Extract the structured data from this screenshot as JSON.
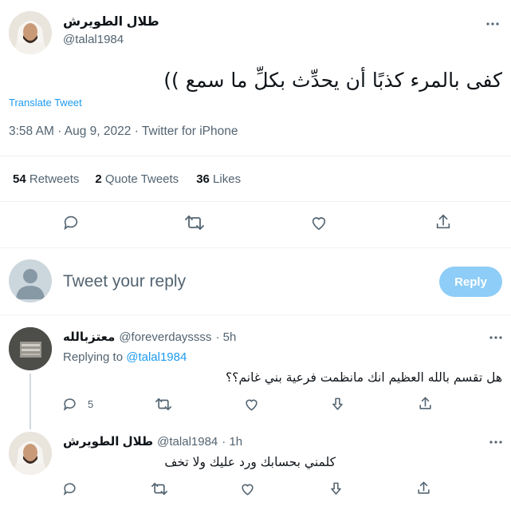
{
  "tweet": {
    "author_name": "طلال الطويرش",
    "author_handle": "@talal1984",
    "text": "كفى بالمرء كذبًا أن يحدِّث بكلِّ ما سمع ))",
    "translate_label": "Translate Tweet",
    "timestamp": "3:58 AM · Aug 9, 2022 · Twitter for iPhone",
    "stats": {
      "retweets_count": "54",
      "retweets_label": "Retweets",
      "quotes_count": "2",
      "quotes_label": "Quote Tweets",
      "likes_count": "36",
      "likes_label": "Likes"
    }
  },
  "composer": {
    "placeholder": "Tweet your reply",
    "reply_button_label": "Reply"
  },
  "replies": [
    {
      "author_name": "معتزبالله",
      "author_handle": "@foreverdayssss",
      "time": "· 5h",
      "replying_to_label": "Replying to",
      "replying_to_handle": "@talal1984",
      "text": "هل تقسم بالله العظيم انك مانظمت فرعية بني غانم؟؟",
      "reply_count": "5"
    },
    {
      "author_name": "طلال الطويرش",
      "author_handle": "@talal1984",
      "time": "· 1h",
      "text": "كلمني بحسابك ورد عليك ولا تخف"
    }
  ],
  "icons": {
    "reply": "reply-icon",
    "retweet": "retweet-icon",
    "like": "heart-icon",
    "share": "share-icon",
    "more": "more-icon",
    "downvote": "downvote-icon"
  },
  "colors": {
    "link": "#1d9bf0",
    "muted": "#536471",
    "reply_button": "#8ecdf7",
    "divider": "#eff3f4"
  }
}
